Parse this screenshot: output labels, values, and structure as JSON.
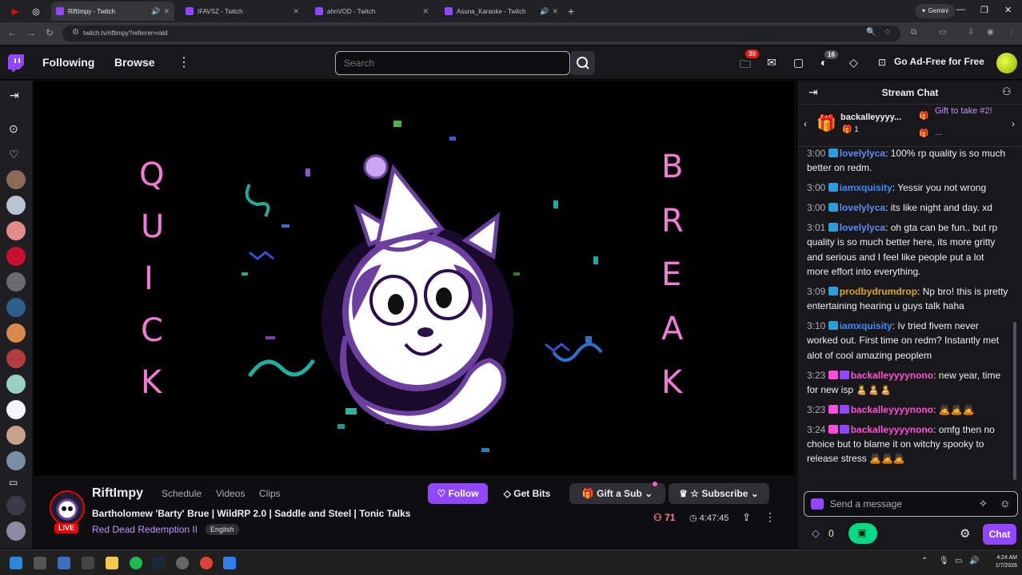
{
  "browser": {
    "tabs": [
      {
        "title": "RiftImpy - Twitch",
        "active": true
      },
      {
        "title": "IFAVSZ - Twitch",
        "active": false
      },
      {
        "title": "ahnVOD - Twitch",
        "active": false
      },
      {
        "title": "Asuna_Karaoke - Twitch",
        "active": false
      }
    ],
    "url": "twitch.tv/riftimpy?referrer=raid",
    "gemini_label": "Gemini"
  },
  "topnav": {
    "following": "Following",
    "browse": "Browse",
    "search_placeholder": "Search",
    "notif_count": "30",
    "drops_count": "16",
    "ad_free": "Go Ad-Free for Free"
  },
  "player": {
    "left_word": [
      "Q",
      "U",
      "I",
      "C",
      "K"
    ],
    "right_word": [
      "B",
      "R",
      "E",
      "A",
      "K"
    ]
  },
  "stream": {
    "channel": "RiftImpy",
    "tabs": [
      "Schedule",
      "Videos",
      "Clips"
    ],
    "title": "Bartholomew 'Barty' Brue | WildRP 2.0 | Saddle and Steel | Tonic Talks",
    "game": "Red Dead Redemption II",
    "language": "English",
    "live": "LIVE",
    "follow": "Follow",
    "get_bits": "Get Bits",
    "gift_sub": "Gift a Sub",
    "subscribe": "Subscribe",
    "viewers": "71",
    "uptime": "4:47:45"
  },
  "chat": {
    "title": "Stream Chat",
    "gift_user": "backalleyyyy...",
    "gift_count": "1",
    "gift_take": "Gift to take #2!",
    "gift_more": "...",
    "messages": [
      {
        "time": "3:00",
        "user": "lovelylyca",
        "color": "#5b8cff",
        "text": "100% rp quality is so much better on redm."
      },
      {
        "time": "3:00",
        "user": "iamxquisity",
        "color": "#3c8cff",
        "text": "Yessir you not wrong"
      },
      {
        "time": "3:00",
        "user": "lovelylyca",
        "color": "#5b8cff",
        "text": "its like night and day. xd"
      },
      {
        "time": "3:01",
        "user": "lovelylyca",
        "color": "#5b8cff",
        "text": "oh gta can be fun.. but rp quality is so much better here, its more gritty and serious and I feel like people put a lot more effort into everything."
      },
      {
        "time": "3:09",
        "user": "prodbydrumdrop",
        "color": "#daa520",
        "text": "Np bro! this is pretty entertaining hearing u guys talk haha"
      },
      {
        "time": "3:10",
        "user": "iamxquisity",
        "color": "#3c8cff",
        "text": "Iv tried fivem never worked out. First time on redm? Instantly met alot of cool amazing peoplem"
      },
      {
        "time": "3:23",
        "user": "backalleyyyynono",
        "color": "#ff4fd8",
        "text": "new year, time for new isp 🧑‍🍼🧑‍🍼🧑‍🍼"
      },
      {
        "time": "3:23",
        "user": "backalleyyyynono",
        "color": "#ff4fd8",
        "text": "🙇🙇🙇"
      },
      {
        "time": "3:24",
        "user": "backalleyyyynono",
        "color": "#ff4fd8",
        "text": "omfg then no choice but to blame it on witchy spooky to release stress 🙇🙇🙇"
      }
    ],
    "input_placeholder": "Send a message",
    "points": "0",
    "chat_button": "Chat"
  },
  "taskbar": {
    "time": "4:24 AM",
    "date": "1/7/2026"
  },
  "colors": {
    "accent": "#9146ff",
    "live": "#eb0400",
    "letters": "#f27bd6"
  }
}
